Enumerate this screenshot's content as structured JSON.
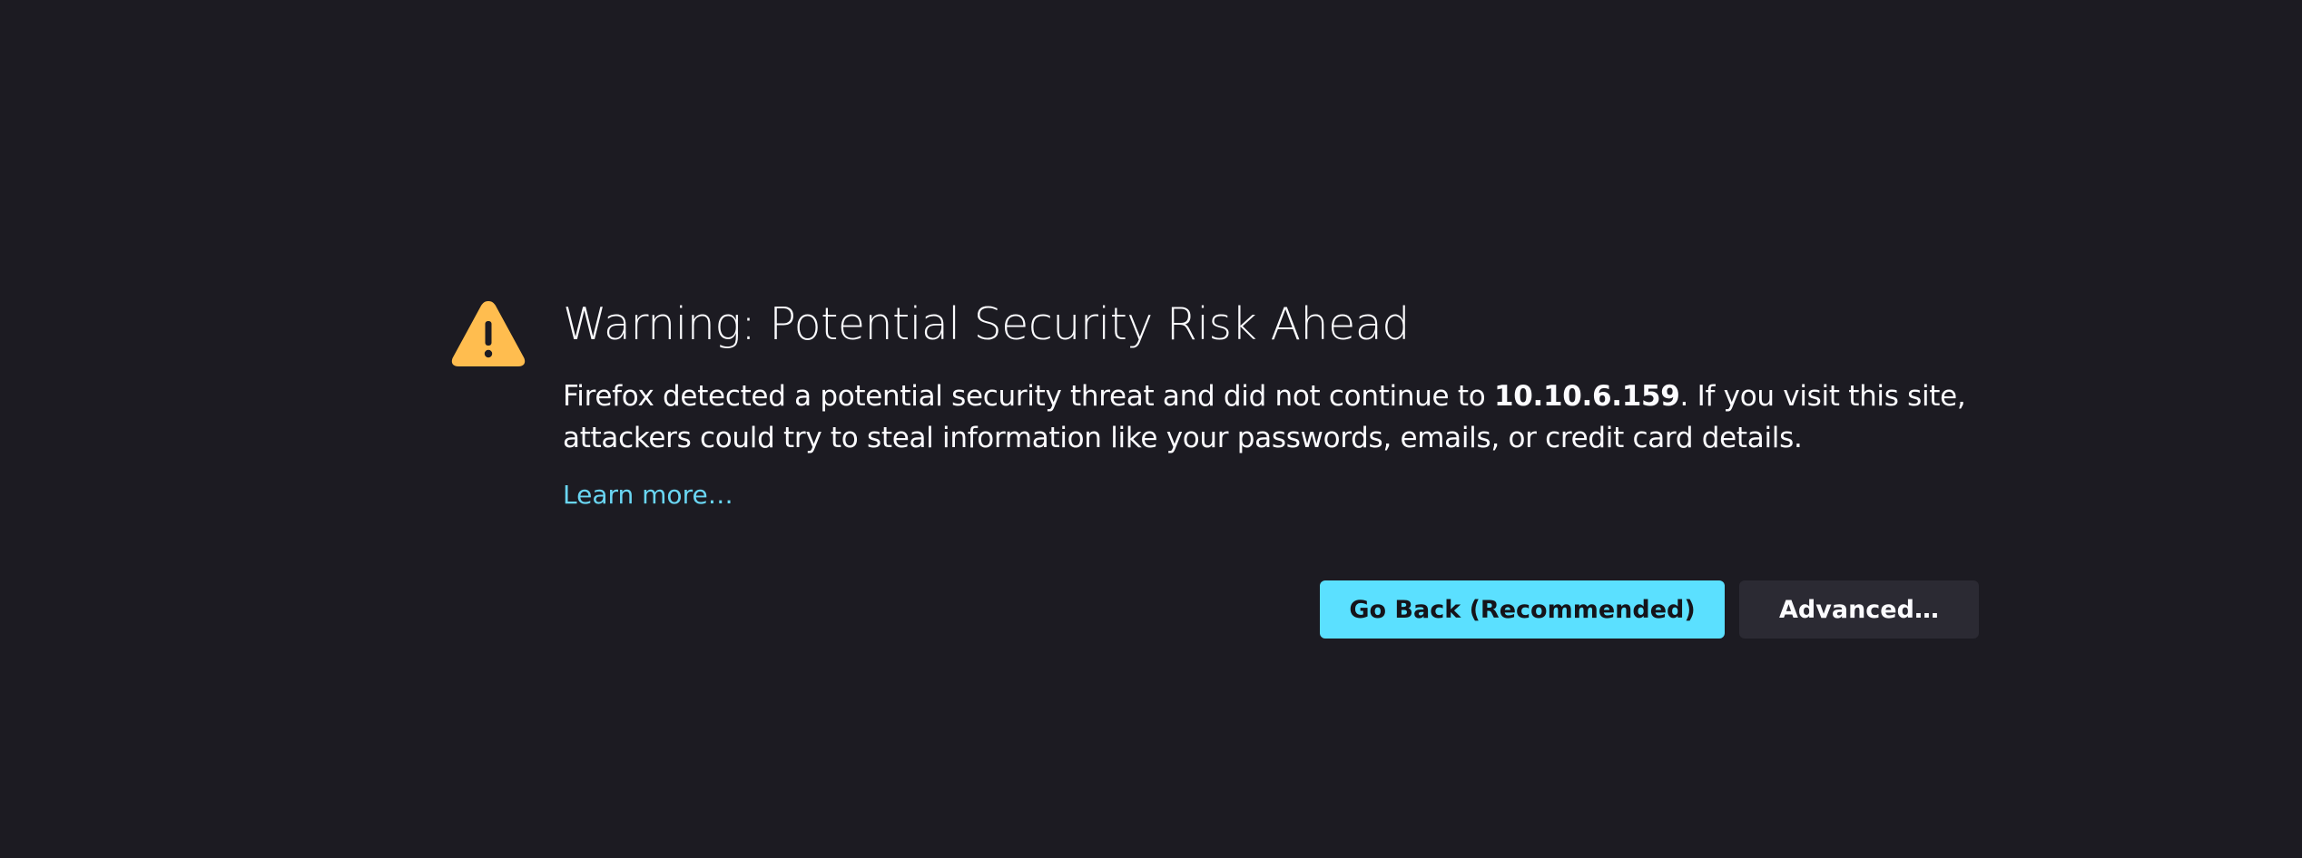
{
  "icon": {
    "name": "warning-icon",
    "color": "#ffbd4f"
  },
  "title": "Warning: Potential Security Risk Ahead",
  "description": {
    "before_host": "Firefox detected a potential security threat and did not continue to ",
    "host": "10.10.6.159",
    "after_host": ". If you visit this site, attackers could try to steal information like your passwords, emails, or credit card details."
  },
  "learn_more": "Learn more…",
  "buttons": {
    "go_back": "Go Back (Recommended)",
    "advanced": "Advanced…"
  },
  "colors": {
    "background": "#1c1b22",
    "accent": "#5be0ff",
    "link": "#6ad6f3"
  }
}
